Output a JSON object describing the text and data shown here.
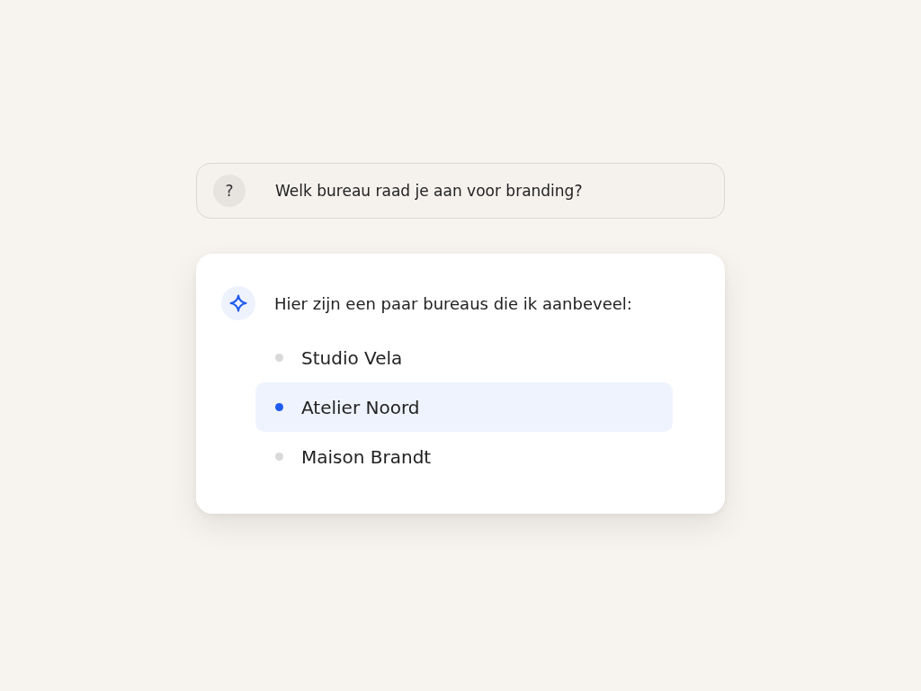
{
  "question": {
    "icon": "?",
    "text": "Welk bureau raad je aan voor branding?"
  },
  "answer": {
    "intro": "Hier zijn een paar bureaus die ik aanbeveel:",
    "items": [
      {
        "label": "Studio Vela",
        "selected": false
      },
      {
        "label": "Atelier Noord",
        "selected": true
      },
      {
        "label": "Maison Brandt",
        "selected": false
      }
    ]
  }
}
